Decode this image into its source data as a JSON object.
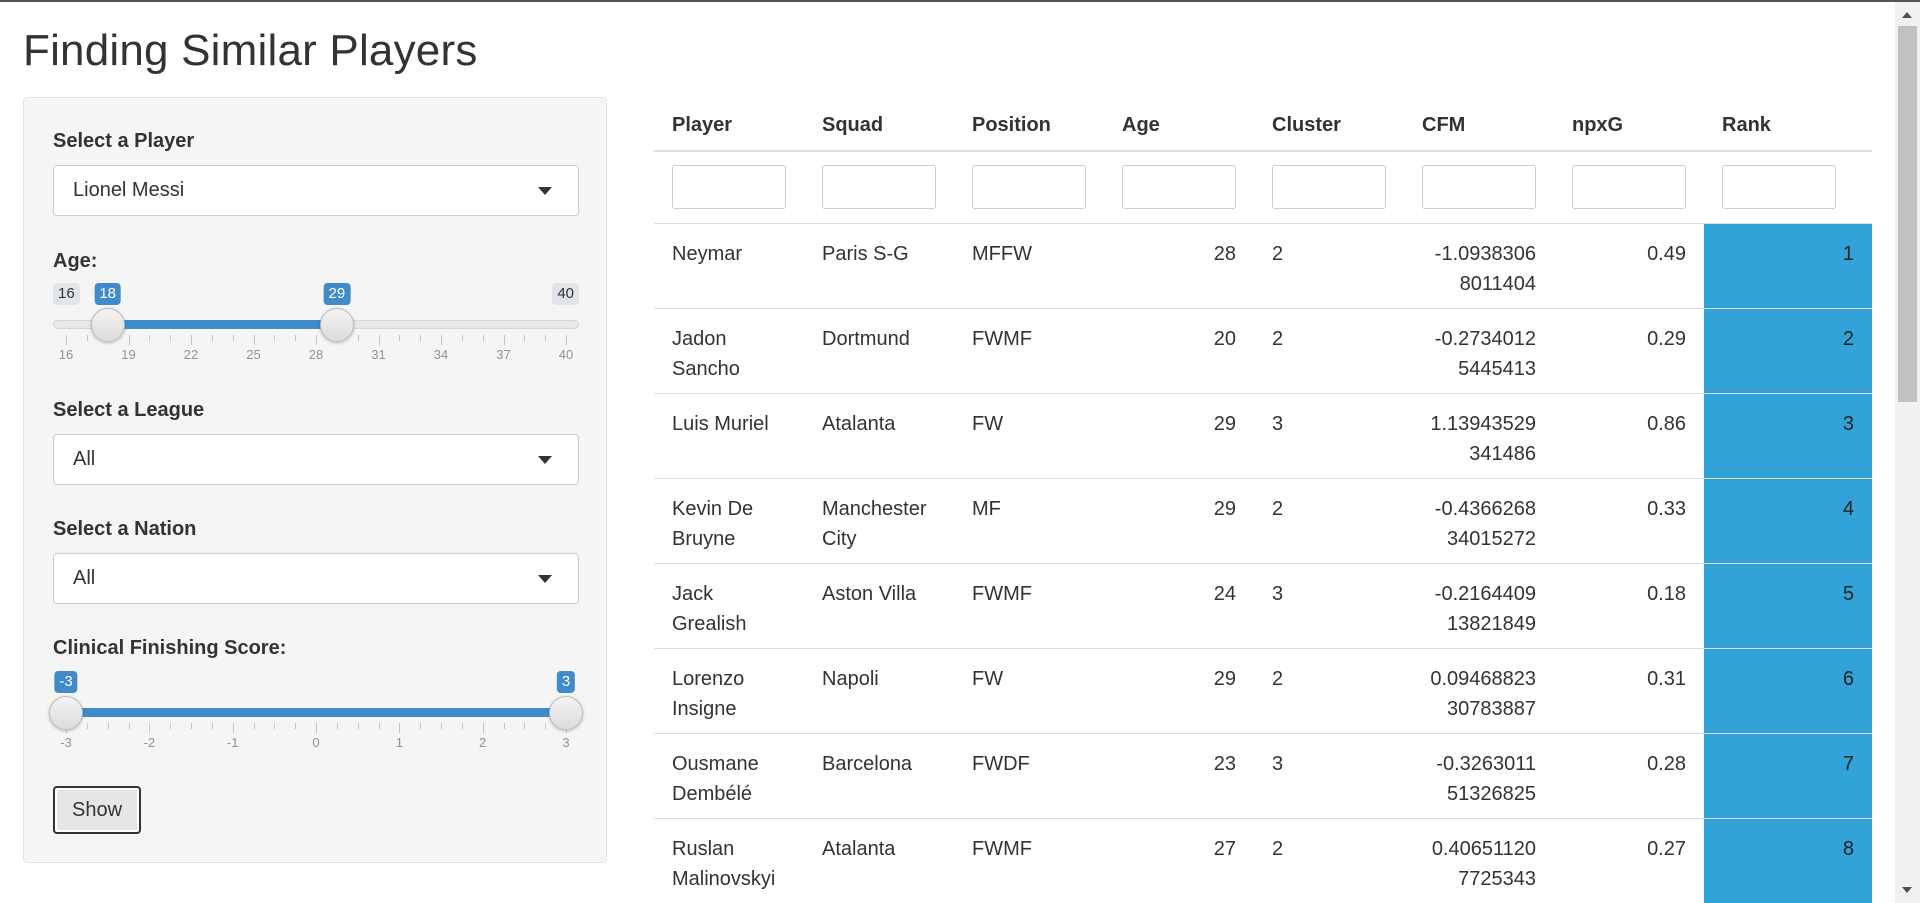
{
  "page": {
    "title": "Finding Similar Players"
  },
  "sidebar": {
    "player": {
      "label": "Select a Player",
      "value": "Lionel Messi"
    },
    "age": {
      "label": "Age:",
      "min": "16",
      "max": "40",
      "from": "18",
      "to": "29",
      "ticks": [
        "16",
        "19",
        "22",
        "25",
        "28",
        "31",
        "34",
        "37",
        "40"
      ]
    },
    "league": {
      "label": "Select a League",
      "value": "All"
    },
    "nation": {
      "label": "Select a Nation",
      "value": "All"
    },
    "cfs": {
      "label": "Clinical Finishing Score:",
      "from": "-3",
      "to": "3",
      "ticks": [
        "-3",
        "-2",
        "-1",
        "0",
        "1",
        "2",
        "3"
      ]
    },
    "show_label": "Show"
  },
  "table": {
    "columns": [
      "Player",
      "Squad",
      "Position",
      "Age",
      "Cluster",
      "CFM",
      "npxG",
      "Rank"
    ],
    "rows": [
      {
        "player": "Neymar",
        "squad": "Paris S-G",
        "position": "MFFW",
        "age": "28",
        "cluster": "2",
        "cfm": "-1.0938306\n8011404",
        "npxg": "0.49",
        "rank": "1"
      },
      {
        "player": "Jadon Sancho",
        "squad": "Dortmund",
        "position": "FWMF",
        "age": "20",
        "cluster": "2",
        "cfm": "-0.2734012\n5445413",
        "npxg": "0.29",
        "rank": "2"
      },
      {
        "player": "Luis Muriel",
        "squad": "Atalanta",
        "position": "FW",
        "age": "29",
        "cluster": "3",
        "cfm": "1.13943529\n341486",
        "npxg": "0.86",
        "rank": "3"
      },
      {
        "player": "Kevin De Bruyne",
        "squad": "Manchester City",
        "position": "MF",
        "age": "29",
        "cluster": "2",
        "cfm": "-0.4366268\n34015272",
        "npxg": "0.33",
        "rank": "4"
      },
      {
        "player": "Jack Grealish",
        "squad": "Aston Villa",
        "position": "FWMF",
        "age": "24",
        "cluster": "3",
        "cfm": "-0.2164409\n13821849",
        "npxg": "0.18",
        "rank": "5"
      },
      {
        "player": "Lorenzo Insigne",
        "squad": "Napoli",
        "position": "FW",
        "age": "29",
        "cluster": "2",
        "cfm": "0.09468823\n30783887",
        "npxg": "0.31",
        "rank": "6"
      },
      {
        "player": "Ousmane Dembélé",
        "squad": "Barcelona",
        "position": "FWDF",
        "age": "23",
        "cluster": "3",
        "cfm": "-0.3263011\n51326825",
        "npxg": "0.28",
        "rank": "7"
      },
      {
        "player": "Ruslan Malinovskyi",
        "squad": "Atalanta",
        "position": "FWMF",
        "age": "27",
        "cluster": "2",
        "cfm": "0.40651120\n7725343",
        "npxg": "0.27",
        "rank": "8"
      }
    ]
  },
  "colors": {
    "accent": "#428bca",
    "rank_fill": "#31a3d8"
  }
}
